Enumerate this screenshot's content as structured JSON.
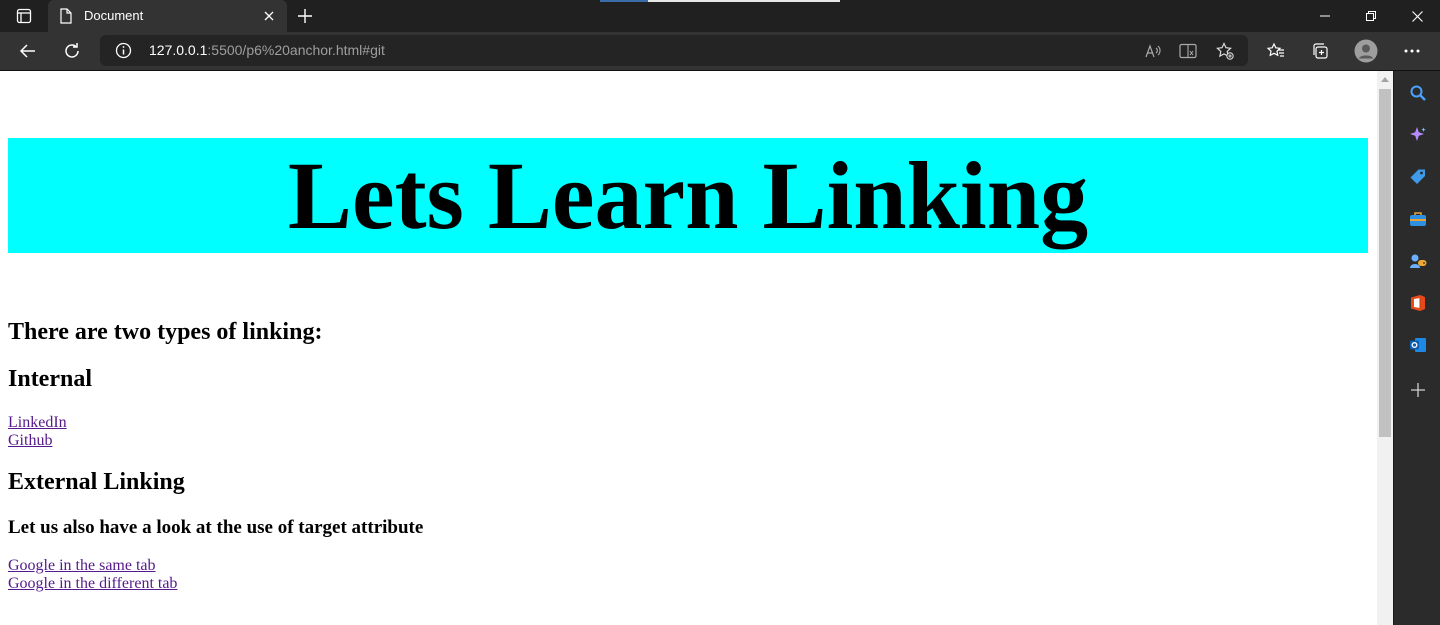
{
  "browser": {
    "tab_title": "Document",
    "url_host": "127.0.0.1",
    "url_rest": ":5500/p6%20anchor.html#git",
    "icons": [
      "tab-actions-icon",
      "document-icon",
      "close-icon",
      "new-tab-icon",
      "minimize-icon",
      "restore-icon",
      "window-close-icon",
      "back-icon",
      "refresh-icon",
      "info-icon",
      "read-aloud-icon",
      "immersive-reader-icon",
      "add-favorite-icon",
      "favorites-icon",
      "collections-icon",
      "profile-icon",
      "more-icon"
    ]
  },
  "sidebar": {
    "icons": [
      "search-icon",
      "copilot-icon",
      "shopping-icon",
      "tools-icon",
      "games-icon",
      "office-icon",
      "outlook-icon",
      "add-icon"
    ]
  },
  "page": {
    "title": "Lets Learn Linking",
    "heading_types": "There are two types of linking:",
    "heading_internal": "Internal",
    "link_linkedin": "LinkedIn",
    "link_github": "Github",
    "heading_external": "External Linking",
    "heading_target": "Let us also have a look at the use of target attribute",
    "link_google_same": "Google in the same tab",
    "link_google_different": "Google in the different tab"
  },
  "colors": {
    "banner_bg": "#00ffff",
    "visited_link": "#551a8b",
    "chrome_dark": "#202020",
    "toolbar": "#333333"
  }
}
